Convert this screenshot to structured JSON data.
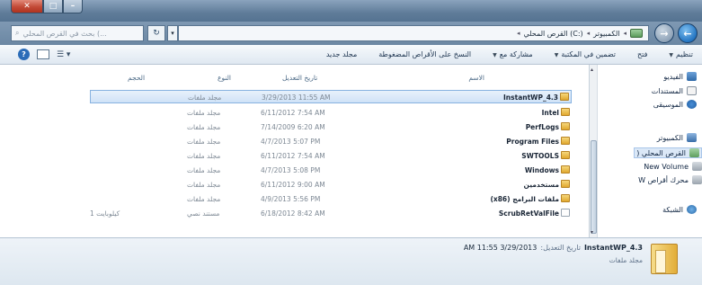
{
  "titlebar": {
    "close_glyph": "✕",
    "max_glyph": "□",
    "min_glyph": "–"
  },
  "address": {
    "search_placeholder": "بحث في القرص المحلي (...",
    "search_icon_glyph": "⌕",
    "refresh_glyph": "↻",
    "history_glyph": "▾",
    "back_glyph": "←",
    "forward_glyph": "→",
    "crumbs": [
      "الكمبيوتر",
      "القرص المحلي (C:)"
    ],
    "crumb_sep": "◂"
  },
  "toolbar": {
    "help_glyph": "?",
    "views_glyph": "☰ ▾",
    "items": [
      {
        "label": "تنظيم",
        "dropdown": true
      },
      {
        "label": "فتح",
        "dropdown": false
      },
      {
        "label": "تضمين في المكتبة",
        "dropdown": true
      },
      {
        "label": "مشاركة مع",
        "dropdown": true
      },
      {
        "label": "النسخ على الأقراص المضغوطة",
        "dropdown": false
      },
      {
        "label": "مجلد جديد",
        "dropdown": false
      }
    ]
  },
  "navigation": {
    "scroll_up": "▴",
    "scroll_down": "▾",
    "items": [
      {
        "label": "الفيديو",
        "icon": "video-icon"
      },
      {
        "label": "المستندات",
        "icon": "documents-icon"
      },
      {
        "label": "الموسيقى",
        "icon": "music-icon"
      },
      {
        "label": "الكمبيوتر",
        "icon": "computer-icon"
      },
      {
        "label": "القرص المحلي (",
        "icon": "local-disk-icon"
      },
      {
        "label": "New Volume",
        "icon": "drive-icon"
      },
      {
        "label": "محرك أقراص W",
        "icon": "dvd-drive-icon"
      },
      {
        "label": "الشبكة",
        "icon": "network-icon"
      }
    ]
  },
  "list": {
    "columns": {
      "name": "الاسم",
      "date": "تاريخ التعديل",
      "type": "النوع",
      "size": "الحجم"
    },
    "rows": [
      {
        "name": "InstantWP_4.3",
        "date": "3/29/2013 11:55 AM",
        "type": "مجلد ملفات",
        "size": "",
        "kind": "folder"
      },
      {
        "name": "Intel",
        "date": "6/11/2012 7:54 AM",
        "type": "مجلد ملفات",
        "size": "",
        "kind": "folder"
      },
      {
        "name": "PerfLogs",
        "date": "7/14/2009 6:20 AM",
        "type": "مجلد ملفات",
        "size": "",
        "kind": "folder"
      },
      {
        "name": "Program Files",
        "date": "4/7/2013 5:07 PM",
        "type": "مجلد ملفات",
        "size": "",
        "kind": "folder"
      },
      {
        "name": "SWTOOLS",
        "date": "6/11/2012 7:54 AM",
        "type": "مجلد ملفات",
        "size": "",
        "kind": "folder"
      },
      {
        "name": "Windows",
        "date": "4/7/2013 5:08 PM",
        "type": "مجلد ملفات",
        "size": "",
        "kind": "folder"
      },
      {
        "name": "مستخدمين",
        "date": "6/11/2012 9:00 AM",
        "type": "مجلد ملفات",
        "size": "",
        "kind": "folder"
      },
      {
        "name": "(x86) ملفات البرامج",
        "date": "4/9/2013 5:56 PM",
        "type": "مجلد ملفات",
        "size": "",
        "kind": "folder"
      },
      {
        "name": "ScrubRetValFile",
        "date": "6/18/2012 8:42 AM",
        "type": "مستند نصي",
        "size": "1 كيلوبايت",
        "kind": "file"
      }
    ]
  },
  "details": {
    "name": "InstantWP_4.3",
    "modified_label": "تاريخ التعديل:",
    "modified_value": "3/29/2013 11:55 AM",
    "type": "مجلد ملفات"
  }
}
